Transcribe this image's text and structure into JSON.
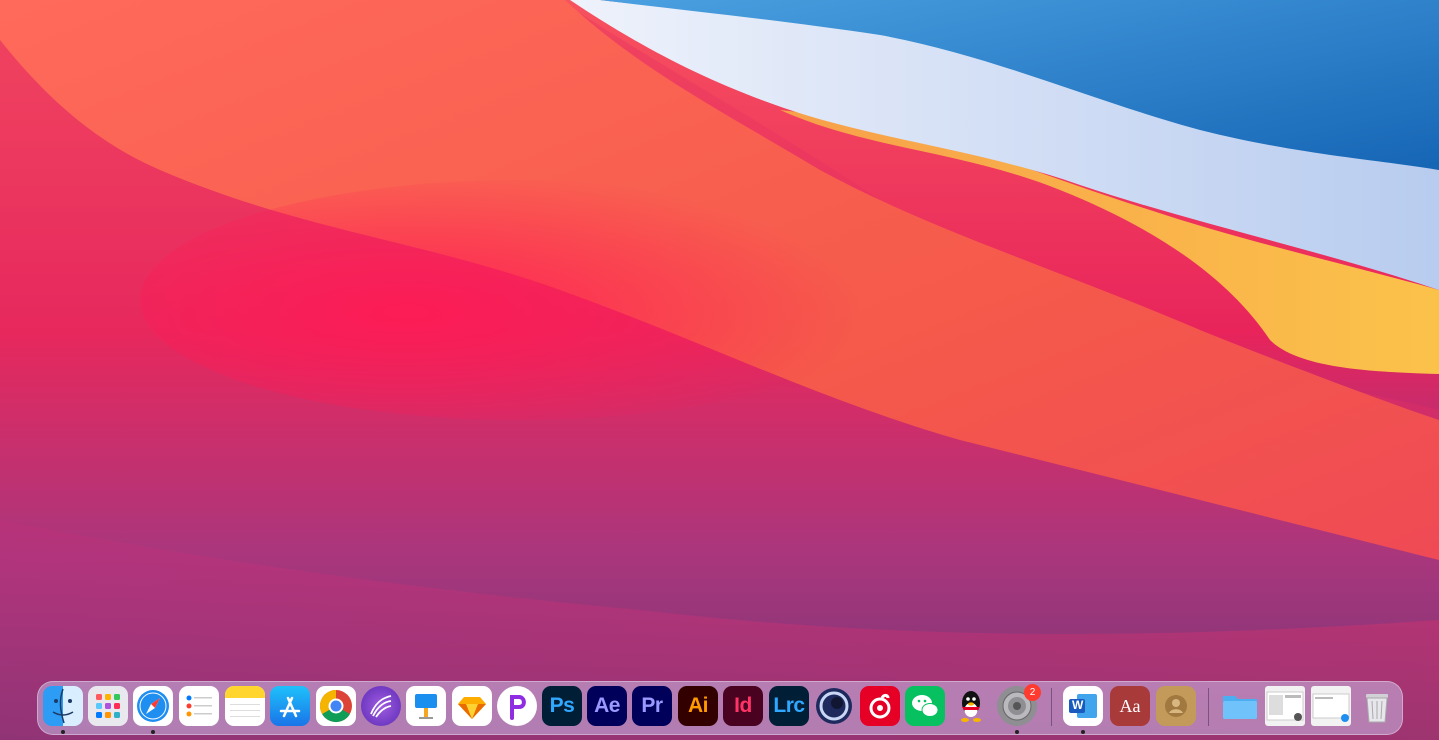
{
  "desktop": {
    "wallpaper": "macos-big-sur-gradient"
  },
  "dock": {
    "apps": [
      {
        "name": "finder",
        "icon": "finder-icon"
      },
      {
        "name": "launchpad",
        "icon": "launchpad-icon"
      },
      {
        "name": "safari",
        "icon": "safari-icon"
      },
      {
        "name": "reminders",
        "icon": "reminders-icon"
      },
      {
        "name": "notes",
        "icon": "notes-icon"
      },
      {
        "name": "app-store",
        "icon": "app-store-icon"
      },
      {
        "name": "chrome",
        "icon": "chrome-icon"
      },
      {
        "name": "app-7",
        "icon": "purple-wave-icon"
      },
      {
        "name": "keynote",
        "icon": "keynote-icon"
      },
      {
        "name": "sketch",
        "icon": "sketch-icon"
      },
      {
        "name": "app-10",
        "icon": "p-logo-icon"
      },
      {
        "name": "photoshop",
        "label": "Ps",
        "icon": "photoshop-icon"
      },
      {
        "name": "after-effects",
        "label": "Ae",
        "icon": "after-effects-icon"
      },
      {
        "name": "premiere",
        "label": "Pr",
        "icon": "premiere-icon"
      },
      {
        "name": "illustrator",
        "label": "Ai",
        "icon": "illustrator-icon"
      },
      {
        "name": "indesign",
        "label": "Id",
        "icon": "indesign-icon"
      },
      {
        "name": "lightroom-classic",
        "label": "Lrc",
        "icon": "lightroom-icon"
      },
      {
        "name": "cinema-4d",
        "icon": "cinema4d-icon"
      },
      {
        "name": "netease-music",
        "icon": "netease-music-icon"
      },
      {
        "name": "wechat",
        "icon": "wechat-icon"
      },
      {
        "name": "qq",
        "icon": "qq-penguin-icon"
      },
      {
        "name": "system-preferences",
        "icon": "gear-icon",
        "badge": "2"
      },
      {
        "name": "word",
        "label": "W",
        "icon": "word-icon"
      },
      {
        "name": "dictionary",
        "label": "Aa",
        "icon": "dictionary-icon"
      },
      {
        "name": "contacts",
        "icon": "contacts-icon"
      },
      {
        "name": "folder",
        "icon": "folder-icon"
      },
      {
        "name": "screenshot-1",
        "icon": "screenshot-thumbnail-icon"
      },
      {
        "name": "screenshot-2",
        "icon": "screenshot-thumbnail-icon"
      },
      {
        "name": "trash",
        "icon": "trash-icon"
      }
    ]
  },
  "colors": {
    "ps": "#31a8ff",
    "ae": "#9999ff",
    "pr": "#9999ff",
    "ai": "#ff9a00",
    "id": "#ff3366",
    "lrc": "#31a8ff"
  }
}
